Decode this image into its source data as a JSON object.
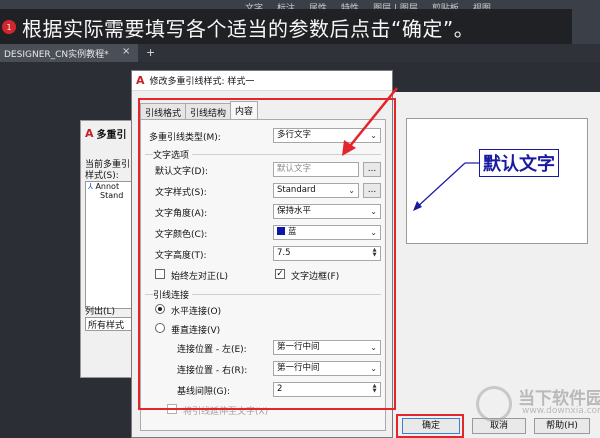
{
  "banner": {
    "step": "1",
    "text": "根据实际需要填写各个适当的参数后点击“确定”。"
  },
  "ribbon_tabs": [
    "文字",
    "标注",
    "属性",
    "特性",
    "图层 | 图层",
    "剪贴板",
    "视图"
  ],
  "doc_tab": {
    "label": "DESIGNER_CN实例教程*",
    "close": "×",
    "plus": "+"
  },
  "back_dialog": {
    "title": "多重引",
    "current_label": "当前多重引",
    "styles_label": "样式(S):",
    "list_items": [
      "Annot",
      "Stand"
    ],
    "list_label": "列出(L)",
    "list_value": "所有样式"
  },
  "dialog": {
    "title": "修改多重引线样式: 样式一",
    "tabs": [
      "引线格式",
      "引线结构",
      "内容"
    ],
    "active_tab": "内容",
    "leader_type_label": "多重引线类型(M):",
    "leader_type_value": "多行文字",
    "text_options": {
      "group_title": "文字选项",
      "default_text_label": "默认文字(D):",
      "default_text_value": "默认文字",
      "text_style_label": "文字样式(S):",
      "text_style_value": "Standard",
      "text_angle_label": "文字角度(A):",
      "text_angle_value": "保持水平",
      "text_color_label": "文字颜色(C):",
      "text_color_value": "蓝",
      "text_color_hex": "#1016a8",
      "text_height_label": "文字高度(T):",
      "text_height_value": "7.5",
      "left_align_label": "始终左对正(L)",
      "left_align_checked": false,
      "frame_label": "文字边框(F)",
      "frame_checked": true
    },
    "leader_connection": {
      "group_title": "引线连接",
      "horizontal_label": "水平连接(O)",
      "horizontal_selected": true,
      "vertical_label": "垂直连接(V)",
      "vertical_selected": false,
      "left_pos_label": "连接位置 - 左(E):",
      "left_pos_value": "第一行中间",
      "right_pos_label": "连接位置 - 右(R):",
      "right_pos_value": "第一行中间",
      "gap_label": "基线间隙(G):",
      "gap_value": "2",
      "extend_label": "将引线延伸至文字(X)"
    },
    "dots": "..."
  },
  "preview": {
    "text": "默认文字"
  },
  "buttons": {
    "ok": "确定",
    "cancel": "取消",
    "help": "帮助(H)"
  },
  "watermark": {
    "title": "当下软件园",
    "url": "www.downxia.com"
  },
  "colors": {
    "annotation_red": "#e2262c",
    "preview_blue": "#1a1aa0"
  }
}
